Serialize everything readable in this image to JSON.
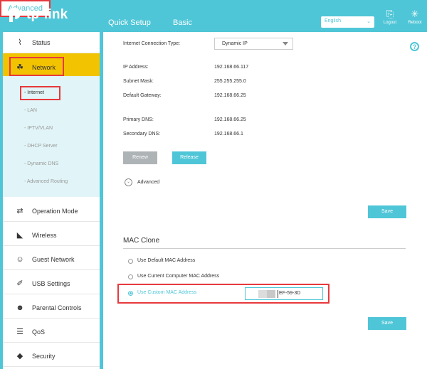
{
  "header": {
    "logo_text": "tp-link",
    "tabs": {
      "quick_setup": "Quick Setup",
      "basic": "Basic",
      "advanced": "Advanced"
    },
    "language": "English",
    "logout_label": "Logout",
    "reboot_label": "Reboot"
  },
  "sidebar": {
    "items": [
      {
        "label": "Status",
        "icon": "pulse-icon"
      },
      {
        "label": "Network",
        "icon": "network-icon"
      },
      {
        "label": "Operation Mode",
        "icon": "operation-mode-icon"
      },
      {
        "label": "Wireless",
        "icon": "wifi-icon"
      },
      {
        "label": "Guest Network",
        "icon": "guest-icon"
      },
      {
        "label": "USB Settings",
        "icon": "usb-icon"
      },
      {
        "label": "Parental Controls",
        "icon": "parental-icon"
      },
      {
        "label": "QoS",
        "icon": "qos-icon"
      },
      {
        "label": "Security",
        "icon": "shield-icon"
      }
    ],
    "submenu": [
      "- Internet",
      "- LAN",
      "- IPTV/VLAN",
      "- DHCP Server",
      "- Dynamic DNS",
      "- Advanced Routing"
    ]
  },
  "main": {
    "connection_type_label": "Internet Connection Type:",
    "connection_type_value": "Dynamic IP",
    "ip_label": "IP Address:",
    "ip_value": "192.168.66.117",
    "subnet_label": "Subnet Mask:",
    "subnet_value": "255.255.255.0",
    "gateway_label": "Default Gateway:",
    "gateway_value": "192.168.66.25",
    "primary_dns_label": "Primary DNS:",
    "primary_dns_value": "192.168.66.25",
    "secondary_dns_label": "Secondary DNS:",
    "secondary_dns_value": "192.168.66.1",
    "renew_label": "Renew",
    "release_label": "Release",
    "advanced_label": "Advanced",
    "save_label": "Save",
    "mac_clone_title": "MAC Clone",
    "mac_options": [
      "Use Default MAC Address",
      "Use Current Computer MAC Address",
      "Use Custom MAC Address"
    ],
    "mac_value_visible": "EF-59-3D"
  },
  "colors": {
    "accent": "#4fc6d7",
    "active_nav": "#f2c300",
    "highlight_border": "#e7393e"
  }
}
